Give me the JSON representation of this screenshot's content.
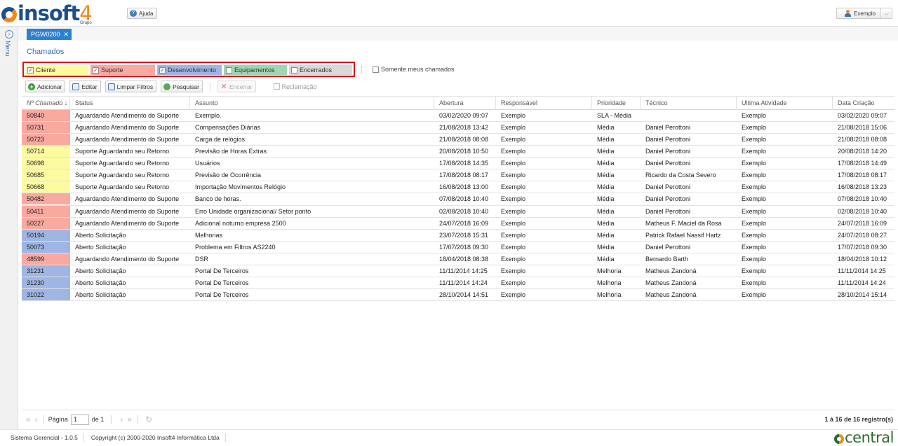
{
  "app": {
    "logo_text": "insoft",
    "logo_num": "4",
    "logo_sub": "Grupo",
    "help_label": "Ajuda",
    "user_label": "Exemplo",
    "menu_label": "Menu"
  },
  "tab": {
    "label": "PGW0200"
  },
  "page": {
    "title": "Chamados"
  },
  "filters": [
    {
      "label": "Cliente",
      "checked": true,
      "color": "#fdfba0"
    },
    {
      "label": "Suporte",
      "checked": true,
      "color": "#f8a9a0"
    },
    {
      "label": "Desenvolvimento",
      "checked": true,
      "color": "#9fb5e3"
    },
    {
      "label": "Equipamentos",
      "checked": false,
      "color": "#9fd6b3"
    },
    {
      "label": "Encerrados",
      "checked": false,
      "color": "#d9d9d9"
    }
  ],
  "only_mine": {
    "label": "Somente meus chamados",
    "checked": false
  },
  "toolbar": {
    "add": "Adicionar",
    "edit": "Editar",
    "clear": "Limpar Filtros",
    "search": "Pesquisar",
    "close": "Encerrar",
    "complaint": "Reclamação"
  },
  "grid": {
    "columns": [
      "Nº Chamado ↓",
      "Status",
      "Assunto",
      "Abertura",
      "Responsável",
      "Prioridade",
      "Técnico",
      "Ultima Atividade",
      "Data Criação"
    ],
    "rows": [
      {
        "id": "50840",
        "color": "#f8a9a0",
        "status": "Aguardando Atendimento do Suporte",
        "subject": "Exemplo.",
        "opened": "03/02/2020 09:07",
        "resp": "Exemplo",
        "priority": "SLA - Média",
        "tech": "",
        "last": "Exemplo",
        "created": "03/02/2020 09:07"
      },
      {
        "id": "50731",
        "color": "#f8a9a0",
        "status": "Aguardando Atendimento do Suporte",
        "subject": "Compensações Diárias",
        "opened": "21/08/2018 13:42",
        "resp": "Exemplo",
        "priority": "Média",
        "tech": "Daniel Perottoni",
        "last": "Exemplo",
        "created": "21/08/2018 15:06"
      },
      {
        "id": "50723",
        "color": "#f8a9a0",
        "status": "Aguardando Atendimento do Suporte",
        "subject": "Carga de relógios",
        "opened": "21/08/2018 08:08",
        "resp": "Exemplo",
        "priority": "Média",
        "tech": "Daniel Perottoni",
        "last": "Exemplo",
        "created": "21/08/2018 08:08"
      },
      {
        "id": "50714",
        "color": "#fdfba0",
        "status": "Suporte Aguardando seu Retorno",
        "subject": "Previsão de Horas Extras",
        "opened": "20/08/2018 10:50",
        "resp": "Exemplo",
        "priority": "Média",
        "tech": "Daniel Perottoni",
        "last": "Exemplo",
        "created": "20/08/2018 14:20"
      },
      {
        "id": "50698",
        "color": "#fdfba0",
        "status": "Suporte Aguardando seu Retorno",
        "subject": "Usuários",
        "opened": "17/08/2018 14:35",
        "resp": "Exemplo",
        "priority": "Média",
        "tech": "Daniel Perottoni",
        "last": "Exemplo",
        "created": "17/08/2018 14:49"
      },
      {
        "id": "50685",
        "color": "#fdfba0",
        "status": "Suporte Aguardando seu Retorno",
        "subject": "Previsão de Ocorrência",
        "opened": "17/08/2018 08:17",
        "resp": "Exemplo",
        "priority": "Média",
        "tech": "Ricardo da Costa Severo",
        "last": "Exemplo",
        "created": "17/08/2018 08:17"
      },
      {
        "id": "50668",
        "color": "#fdfba0",
        "status": "Suporte Aguardando seu Retorno",
        "subject": "Importação Movimentos Relógio",
        "opened": "16/08/2018 13:00",
        "resp": "Exemplo",
        "priority": "Média",
        "tech": "Daniel Perottoni",
        "last": "Exemplo",
        "created": "16/08/2018 13:23"
      },
      {
        "id": "50482",
        "color": "#f8a9a0",
        "status": "Aguardando Atendimento do Suporte",
        "subject": "Banco de horas.",
        "opened": "07/08/2018 10:40",
        "resp": "Exemplo",
        "priority": "Média",
        "tech": "Daniel Perottoni",
        "last": "Exemplo",
        "created": "07/08/2018 10:40"
      },
      {
        "id": "50411",
        "color": "#f8a9a0",
        "status": "Aguardando Atendimento do Suporte",
        "subject": "Erro Unidade organizacional/ Setor ponto",
        "opened": "02/08/2018 10:40",
        "resp": "Exemplo",
        "priority": "Média",
        "tech": "Daniel Perottoni",
        "last": "Exemplo",
        "created": "02/08/2018 10:40"
      },
      {
        "id": "50227",
        "color": "#f8a9a0",
        "status": "Aguardando Atendimento do Suporte",
        "subject": "Adicional noturno empresa 2500",
        "opened": "24/07/2018 16:09",
        "resp": "Exemplo",
        "priority": "Média",
        "tech": "Matheus F. Maciel da Rosa",
        "last": "Exemplo",
        "created": "24/07/2018 16:09"
      },
      {
        "id": "50194",
        "color": "#9fb5e3",
        "status": "Aberto Solicitação",
        "subject": "Melhorias",
        "opened": "23/07/2018 15:31",
        "resp": "Exemplo",
        "priority": "Média",
        "tech": "Patrick Rafael Nassif Hartz",
        "last": "Exemplo",
        "created": "24/07/2018 08:27"
      },
      {
        "id": "50073",
        "color": "#9fb5e3",
        "status": "Aberto Solicitação",
        "subject": "Problema em Filtros AS2240",
        "opened": "17/07/2018 09:30",
        "resp": "Exemplo",
        "priority": "Média",
        "tech": "Daniel Perottoni",
        "last": "Exemplo",
        "created": "17/07/2018 09:30"
      },
      {
        "id": "48599",
        "color": "#f8a9a0",
        "status": "Aguardando Atendimento do Suporte",
        "subject": "DSR",
        "opened": "18/04/2018 08:38",
        "resp": "Exemplo",
        "priority": "Média",
        "tech": "Bernardo Barth",
        "last": "Exemplo",
        "created": "18/04/2018 10:12"
      },
      {
        "id": "31231",
        "color": "#9fb5e3",
        "status": "Aberto Solicitação",
        "subject": "Portal De Terceiros",
        "opened": "11/11/2014 14:25",
        "resp": "Exemplo",
        "priority": "Melhoria",
        "tech": "Matheus Zandoná",
        "last": "Exemplo",
        "created": "11/11/2014 14:25"
      },
      {
        "id": "31230",
        "color": "#9fb5e3",
        "status": "Aberto Solicitação",
        "subject": "Portal De Terceiros",
        "opened": "11/11/2014 14:24",
        "resp": "Exemplo",
        "priority": "Melhoria",
        "tech": "Matheus Zandoná",
        "last": "Exemplo",
        "created": "11/11/2014 14:24"
      },
      {
        "id": "31022",
        "color": "#9fb5e3",
        "status": "Aberto Solicitação",
        "subject": "Portal De Terceiros",
        "opened": "28/10/2014 14:51",
        "resp": "Exemplo",
        "priority": "Melhoria",
        "tech": "Matheus Zandoná",
        "last": "Exemplo",
        "created": "28/10/2014 15:14"
      }
    ]
  },
  "pager": {
    "page_label": "Página",
    "page_value": "1",
    "of_label": "de 1",
    "info": "1 à 16 de 16 registro(s)"
  },
  "footer": {
    "version": "Sistema Gerencial - 1.0.5",
    "copyright": "Copyright (c) 2000-2020 Insoft4 Informática Ltda",
    "brand": "central"
  }
}
